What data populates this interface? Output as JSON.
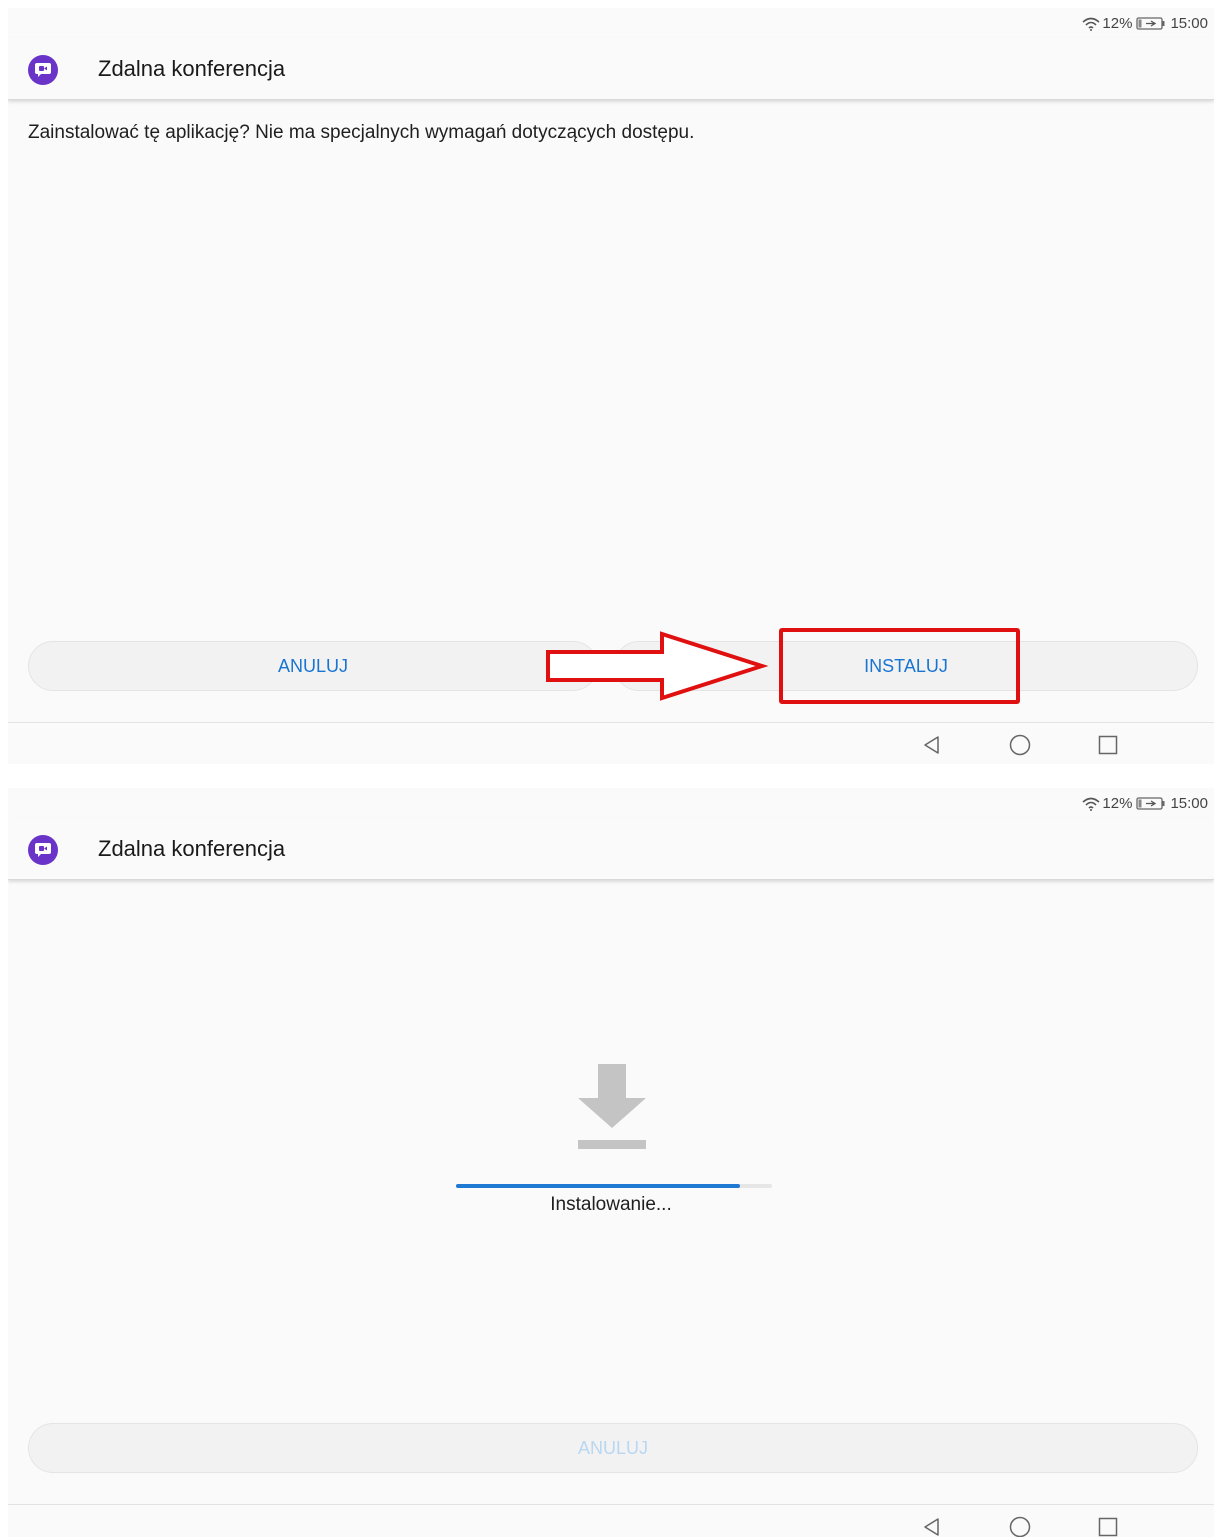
{
  "screens": [
    {
      "status": {
        "battery": "12%",
        "time": "15:00",
        "wifi_icon": "wifi-icon",
        "battery_icon": "battery-charging-icon"
      },
      "app": {
        "title": "Zdalna konferencja",
        "icon": "video-conference-icon",
        "icon_color": "#6a34c9"
      },
      "prompt": "Zainstalować tę aplikację? Nie ma specjalnych wymagań dotyczących dostępu.",
      "buttons": {
        "cancel": "ANULUJ",
        "install": "INSTALUJ"
      },
      "annotation": {
        "arrow_color": "#e01010",
        "highlight_target": "install-button"
      },
      "nav": [
        "back-icon",
        "home-icon",
        "recents-icon"
      ]
    },
    {
      "status": {
        "battery": "12%",
        "time": "15:00",
        "wifi_icon": "wifi-icon",
        "battery_icon": "battery-charging-icon"
      },
      "app": {
        "title": "Zdalna konferencja",
        "icon": "video-conference-icon",
        "icon_color": "#6a34c9"
      },
      "install_state": {
        "label": "Instalowanie...",
        "progress": 0.9,
        "icon": "download-icon"
      },
      "buttons": {
        "cancel": "ANULUJ",
        "cancel_disabled": true
      },
      "nav": [
        "back-icon",
        "home-icon",
        "recents-icon"
      ]
    }
  ],
  "colors": {
    "accent": "#1875d2",
    "progress": "#1f78d1",
    "disabled_text": "#b9d6f2"
  }
}
